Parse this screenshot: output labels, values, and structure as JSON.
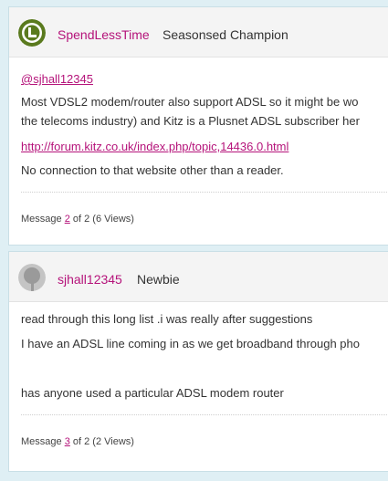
{
  "post1": {
    "author": "SpendLessTime",
    "rank": "Seasonsed Champion",
    "mention": "@sjhall12345",
    "line1": "Most VDSL2 modem/router also support ADSL so it might be wo",
    "line2": "the telecoms industry) and Kitz is a Plusnet ADSL subscriber her",
    "url": "http://forum.kitz.co.uk/index.php/topic,14436.0.html",
    "line3": "No connection to that website other than a reader.",
    "footer_prefix": "Message ",
    "footer_num": "2",
    "footer_suffix": " of 2 (6 Views)"
  },
  "post2": {
    "author": "sjhall12345",
    "rank": "Newbie",
    "line1": "read through this long list .i was really after suggestions",
    "line2": "I have an ADSL line coming in as we get broadband through pho",
    "line3": "has anyone used a particular ADSL modem router",
    "footer_prefix": "Message ",
    "footer_num": "3",
    "footer_suffix": " of 2 (2 Views)"
  },
  "colors": {
    "accent": "#b5137a",
    "avatar_green": "#5a7a1e",
    "avatar_grey": "#9a9a9a",
    "page_bg": "#dfeff4"
  }
}
